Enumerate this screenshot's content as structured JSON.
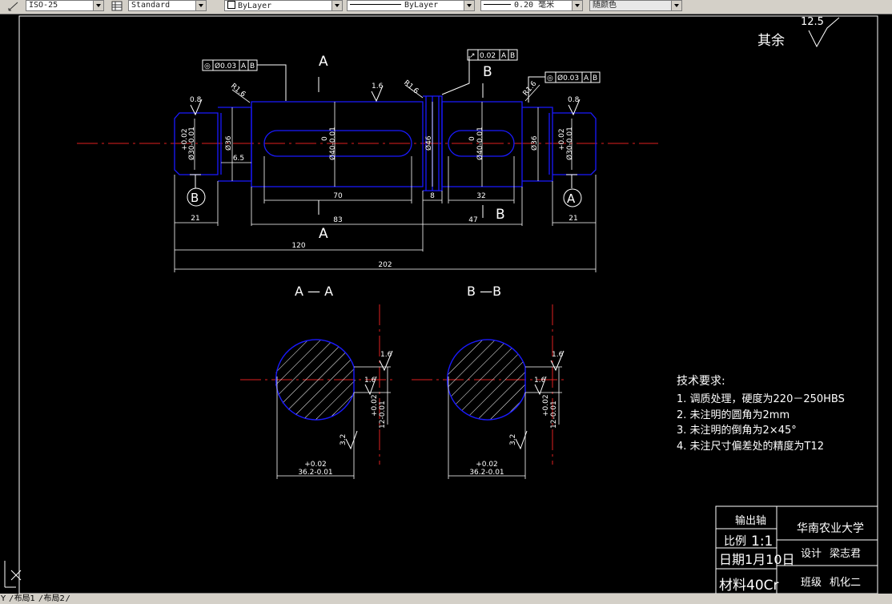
{
  "toolbar": {
    "dimstyle": "ISO-25",
    "tablestyle": "Standard",
    "layer": "ByLayer",
    "linetype": "ByLayer",
    "lineweight": "0.20 毫米",
    "plotstyle": "随颜色"
  },
  "drawing": {
    "surface_rest": "其余",
    "surface_rest_value": "12.5",
    "gdt1": {
      "sym": "◎",
      "tol": "Ø0.03",
      "d1": "A",
      "d2": "B"
    },
    "gdt2": {
      "sym": "↗",
      "tol": "0.02",
      "d1": "A",
      "d2": "B"
    },
    "gdt3": {
      "sym": "◎",
      "tol": "Ø0.03",
      "d1": "A",
      "d2": "B"
    },
    "rough_08": "0.8",
    "rough_16": "1.6",
    "rough_32": "3.2",
    "r16": "R1.6",
    "section_label_a": "A",
    "section_label_b": "B",
    "datum_a": "A",
    "datum_b": "B",
    "dia_30_tol_up": "+0.02",
    "dia_30": "Ø30-0.01",
    "dia_36": "Ø36",
    "dia_40_up": "0",
    "dia_40": "Ø40-0.01",
    "dia_46": "Ø46",
    "dim_21": "21",
    "dim_6_5": "6.5",
    "dim_70": "70",
    "dim_8": "8",
    "dim_32": "32",
    "dim_83": "83",
    "dim_47": "47",
    "dim_120": "120",
    "dim_202": "202",
    "view_aa": "A — A",
    "view_bb": "B —B",
    "sec_tol_up": "+0.02",
    "sec_dim": "36.2-0.01",
    "key_tol_up": "+0.02",
    "key_dim": "12-0.01",
    "tech_title": "技术要求:",
    "tech_items": [
      "1. 调质处理，硬度为220－250HBS",
      "2. 未注明的圆角为2mm",
      "3. 未注明的倒角为2×45°",
      "4. 未注尺寸偏差处的精度为T12"
    ]
  },
  "title_block": {
    "part_name": "输出轴",
    "scale_label": "比例",
    "scale_value": "1:1",
    "date": "日期1月10日",
    "material": "材料40Cr",
    "school": "华南农业大学",
    "designer_label": "设计",
    "designer": "梁志君",
    "class_label": "班级",
    "class_name": "机化二"
  },
  "status": {
    "axis_label": "Y",
    "tab1": "布局1",
    "tab2": "布局2"
  },
  "colors": {
    "background": "#000000",
    "geometry": "#1a1aff",
    "centerline": "#e02020",
    "dimension": "#ffffff"
  }
}
